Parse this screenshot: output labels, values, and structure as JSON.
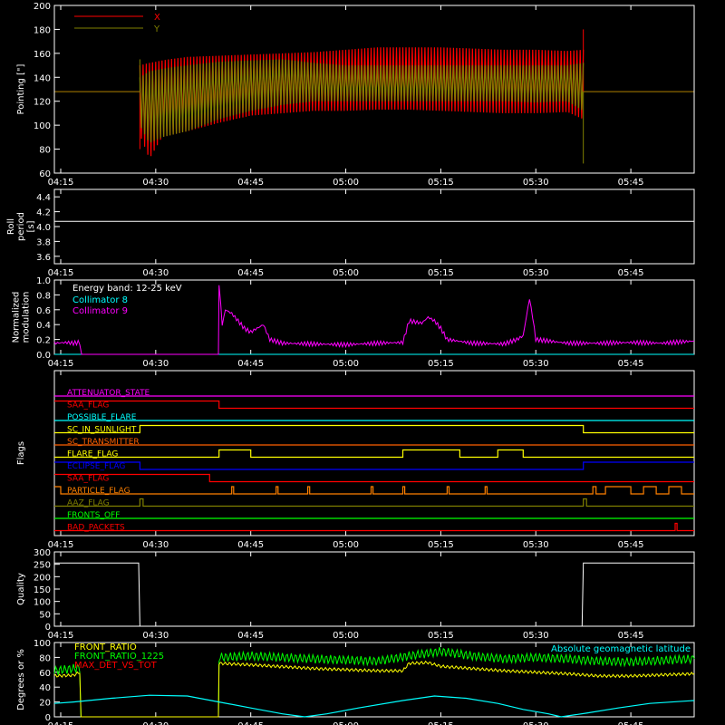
{
  "x_axis": {
    "range_minutes": [
      -1,
      100
    ],
    "ticks": [
      {
        "label": "04:15",
        "m": 0
      },
      {
        "label": "04:30",
        "m": 15
      },
      {
        "label": "04:45",
        "m": 30
      },
      {
        "label": "05:00",
        "m": 45
      },
      {
        "label": "05:15",
        "m": 60
      },
      {
        "label": "05:30",
        "m": 75
      },
      {
        "label": "05:45",
        "m": 90
      }
    ]
  },
  "chart_data": [
    {
      "type": "line",
      "ylabel": "Pointing [\"]",
      "ylim": [
        60,
        200
      ],
      "yticks": [
        60,
        80,
        100,
        120,
        140,
        160,
        180,
        200
      ],
      "series": [
        {
          "name": "X",
          "color": "#ff0000",
          "baseline": 128,
          "data_start": 12.5,
          "data_end": 82.5,
          "band_top": [
            [
              12.5,
              150
            ],
            [
              14,
              152
            ],
            [
              17,
              155
            ],
            [
              20,
              157
            ],
            [
              25,
              158
            ],
            [
              30,
              159
            ],
            [
              35,
              160
            ],
            [
              40,
              161
            ],
            [
              45,
              163
            ],
            [
              50,
              165
            ],
            [
              55,
              165
            ],
            [
              60,
              165
            ],
            [
              65,
              164
            ],
            [
              70,
              163
            ],
            [
              75,
              163
            ],
            [
              80,
              162
            ],
            [
              82.5,
              163
            ]
          ],
          "band_bottom": [
            [
              12.5,
              92
            ],
            [
              14,
              72
            ],
            [
              16,
              90
            ],
            [
              20,
              95
            ],
            [
              25,
              102
            ],
            [
              30,
              108
            ],
            [
              35,
              110
            ],
            [
              40,
              112
            ],
            [
              45,
              112
            ],
            [
              50,
              113
            ],
            [
              55,
              113
            ],
            [
              60,
              112
            ],
            [
              65,
              111
            ],
            [
              70,
              110
            ],
            [
              75,
              110
            ],
            [
              80,
              111
            ],
            [
              82.5,
              105
            ]
          ],
          "spikes": [
            [
              12.5,
              80
            ],
            [
              82.5,
              180
            ]
          ]
        },
        {
          "name": "Y",
          "color": "#808000",
          "baseline": 128,
          "data_start": 12.5,
          "data_end": 82.5,
          "band_top": [
            [
              12.5,
              140
            ],
            [
              14,
              145
            ],
            [
              17,
              148
            ],
            [
              20,
              150
            ],
            [
              25,
              153
            ],
            [
              30,
              154
            ],
            [
              35,
              155
            ],
            [
              40,
              152
            ],
            [
              45,
              150
            ],
            [
              50,
              150
            ],
            [
              55,
              150
            ],
            [
              60,
              150
            ],
            [
              65,
              150
            ],
            [
              70,
              150
            ],
            [
              75,
              150
            ],
            [
              80,
              150
            ],
            [
              82.5,
              152
            ]
          ],
          "band_bottom": [
            [
              12.5,
              100
            ],
            [
              14,
              85
            ],
            [
              16,
              90
            ],
            [
              20,
              95
            ],
            [
              25,
              105
            ],
            [
              30,
              112
            ],
            [
              35,
              117
            ],
            [
              40,
              120
            ],
            [
              45,
              120
            ],
            [
              50,
              120
            ],
            [
              55,
              120
            ],
            [
              60,
              120
            ],
            [
              65,
              120
            ],
            [
              70,
              120
            ],
            [
              75,
              119
            ],
            [
              80,
              120
            ],
            [
              82.5,
              112
            ]
          ],
          "spikes": [
            [
              12.5,
              155
            ],
            [
              82.5,
              68
            ]
          ]
        }
      ]
    },
    {
      "type": "line",
      "ylabel": "Roll period [s]",
      "ylim": [
        3.5,
        4.5
      ],
      "yticks": [
        3.6,
        3.8,
        4.0,
        4.2,
        4.4
      ],
      "series": [
        {
          "color": "#ffffff",
          "points": [
            [
              -1,
              4.07
            ],
            [
              100,
              4.07
            ]
          ]
        }
      ]
    },
    {
      "type": "line",
      "ylabel": "Normalized modulation",
      "ylim": [
        0,
        1.0
      ],
      "yticks": [
        0.0,
        0.2,
        0.4,
        0.6,
        0.8,
        1.0
      ],
      "annotation": "Energy band: 12-25 keV",
      "series": [
        {
          "name": "Collimator 8",
          "color": "#00ffff",
          "points": [
            [
              -1,
              0
            ],
            [
              100,
              0
            ]
          ]
        },
        {
          "name": "Collimator 9",
          "color": "#ff00ff",
          "points": [
            [
              -1,
              0.15
            ],
            [
              1,
              0.16
            ],
            [
              2,
              0.15
            ],
            [
              3,
              0.16
            ],
            [
              3.3,
              0.0
            ],
            [
              24.9,
              0.0
            ],
            [
              25,
              0.95
            ],
            [
              25.5,
              0.4
            ],
            [
              26,
              0.6
            ],
            [
              27,
              0.55
            ],
            [
              28,
              0.45
            ],
            [
              29,
              0.35
            ],
            [
              30,
              0.3
            ],
            [
              31,
              0.35
            ],
            [
              32,
              0.4
            ],
            [
              33,
              0.2
            ],
            [
              35,
              0.15
            ],
            [
              40,
              0.14
            ],
            [
              45,
              0.13
            ],
            [
              50,
              0.15
            ],
            [
              54,
              0.16
            ],
            [
              55,
              0.45
            ],
            [
              57,
              0.42
            ],
            [
              58,
              0.5
            ],
            [
              59,
              0.45
            ],
            [
              60,
              0.35
            ],
            [
              61,
              0.2
            ],
            [
              65,
              0.15
            ],
            [
              70,
              0.14
            ],
            [
              72,
              0.2
            ],
            [
              73,
              0.25
            ],
            [
              74,
              0.75
            ],
            [
              74.5,
              0.5
            ],
            [
              75,
              0.2
            ],
            [
              80,
              0.15
            ],
            [
              85,
              0.15
            ],
            [
              90,
              0.16
            ],
            [
              95,
              0.15
            ],
            [
              100,
              0.18
            ]
          ]
        }
      ]
    },
    {
      "type": "line",
      "ylabel": "Flags",
      "flags": [
        {
          "name": "ATTENUATOR_STATE",
          "color": "#ff00ff",
          "steps": [
            [
              -1,
              0
            ]
          ]
        },
        {
          "name": "SAA_FLAG",
          "color": "#ff0000",
          "steps": [
            [
              -1,
              1
            ],
            [
              25,
              0
            ]
          ]
        },
        {
          "name": "POSSIBLE_FLARE",
          "color": "#00ffff",
          "steps": [
            [
              -1,
              0
            ]
          ]
        },
        {
          "name": "SC_IN_SUNLIGHT",
          "color": "#ffff00",
          "steps": [
            [
              -1,
              0
            ],
            [
              12.5,
              1
            ],
            [
              82.5,
              0
            ]
          ]
        },
        {
          "name": "SC_TRANSMITTER",
          "color": "#ff6000",
          "steps": [
            [
              -1,
              0
            ]
          ]
        },
        {
          "name": "FLARE_FLAG",
          "color": "#ffff00",
          "steps": [
            [
              -1,
              0
            ],
            [
              25,
              1
            ],
            [
              30,
              0
            ],
            [
              54,
              1
            ],
            [
              63,
              0
            ],
            [
              69,
              1
            ],
            [
              73,
              0
            ]
          ]
        },
        {
          "name": "ECLIPSE_FLAG",
          "color": "#0000ff",
          "steps": [
            [
              -1,
              1
            ],
            [
              12.5,
              0
            ],
            [
              82.5,
              1
            ]
          ]
        },
        {
          "name": "SAA_FLAG",
          "color": "#ff0000",
          "steps": [
            [
              -1,
              1
            ],
            [
              23.5,
              0
            ]
          ]
        },
        {
          "name": "PARTICLE_FLAG",
          "color": "#ff8000",
          "steps": [
            [
              -1,
              1
            ],
            [
              0,
              0
            ],
            [
              27,
              1
            ],
            [
              27.3,
              0
            ],
            [
              34,
              1
            ],
            [
              34.3,
              0
            ],
            [
              39,
              1
            ],
            [
              39.3,
              0
            ],
            [
              49,
              1
            ],
            [
              49.3,
              0
            ],
            [
              54,
              1
            ],
            [
              54.3,
              0
            ],
            [
              61,
              1
            ],
            [
              61.3,
              0
            ],
            [
              67,
              1
            ],
            [
              67.3,
              0
            ],
            [
              84,
              1
            ],
            [
              84.5,
              0
            ],
            [
              86,
              1
            ],
            [
              90,
              0
            ],
            [
              92,
              1
            ],
            [
              94,
              0
            ],
            [
              96,
              1
            ],
            [
              98,
              0
            ]
          ]
        },
        {
          "name": "AAZ_FLAG",
          "color": "#808000",
          "steps": [
            [
              -1,
              0
            ],
            [
              12.5,
              1
            ],
            [
              13,
              0
            ],
            [
              82.5,
              1
            ],
            [
              83,
              0
            ]
          ]
        },
        {
          "name": "FRONTS_OFF",
          "color": "#00ff00",
          "steps": [
            [
              -1,
              0
            ]
          ]
        },
        {
          "name": "BAD_PACKETS",
          "color": "#ff0000",
          "steps": [
            [
              -1,
              0
            ],
            [
              97,
              1
            ],
            [
              97.3,
              0
            ]
          ]
        }
      ]
    },
    {
      "type": "line",
      "ylabel": "Quality",
      "ylim": [
        0,
        300
      ],
      "yticks": [
        0,
        50,
        100,
        150,
        200,
        250,
        300
      ],
      "series": [
        {
          "color": "#ffffff",
          "points": [
            [
              -1,
              255
            ],
            [
              12.3,
              255
            ],
            [
              12.5,
              0
            ],
            [
              82.3,
              0
            ],
            [
              82.5,
              255
            ],
            [
              100,
              255
            ]
          ]
        }
      ]
    },
    {
      "type": "line",
      "ylabel": "Degrees or %",
      "ylim": [
        0,
        100
      ],
      "yticks": [
        0,
        20,
        40,
        60,
        80,
        100
      ],
      "series": [
        {
          "name": "FRONT_RATIO",
          "color": "#ffff00",
          "points": [
            [
              -1,
              55
            ],
            [
              2,
              56
            ],
            [
              3,
              60
            ],
            [
              3.2,
              0
            ],
            [
              24.9,
              0
            ],
            [
              25,
              72
            ],
            [
              30,
              70
            ],
            [
              40,
              65
            ],
            [
              50,
              62
            ],
            [
              54,
              62
            ],
            [
              55,
              72
            ],
            [
              58,
              73
            ],
            [
              60,
              68
            ],
            [
              70,
              62
            ],
            [
              80,
              58
            ],
            [
              85,
              55
            ],
            [
              90,
              55
            ],
            [
              100,
              58
            ]
          ]
        },
        {
          "name": "FRONT_RATIO_1225",
          "color": "#00ff00",
          "points": [
            [
              -1,
              62
            ],
            [
              3,
              66
            ],
            [
              3.2,
              0
            ],
            [
              24.9,
              0
            ],
            [
              25,
              80
            ],
            [
              30,
              82
            ],
            [
              40,
              78
            ],
            [
              50,
              75
            ],
            [
              55,
              82
            ],
            [
              60,
              88
            ],
            [
              65,
              82
            ],
            [
              70,
              78
            ],
            [
              75,
              80
            ],
            [
              80,
              78
            ],
            [
              85,
              75
            ],
            [
              90,
              74
            ],
            [
              95,
              76
            ],
            [
              100,
              78
            ]
          ]
        },
        {
          "name": "MAX_DET_VS_TOT",
          "color": "#ff0000",
          "points": []
        },
        {
          "name": "Absolute geomagnetic latitude",
          "color": "#00ffff",
          "points": [
            [
              -1,
              18
            ],
            [
              2,
              20
            ],
            [
              8,
              25
            ],
            [
              14,
              29
            ],
            [
              20,
              28
            ],
            [
              25,
              20
            ],
            [
              30,
              12
            ],
            [
              35,
              4
            ],
            [
              38.5,
              0
            ],
            [
              42,
              4
            ],
            [
              47,
              12
            ],
            [
              54,
              22
            ],
            [
              59,
              28
            ],
            [
              64,
              25
            ],
            [
              69,
              18
            ],
            [
              73,
              10
            ],
            [
              77,
              4
            ],
            [
              79,
              0
            ],
            [
              83,
              5
            ],
            [
              88,
              12
            ],
            [
              93,
              18
            ],
            [
              100,
              22
            ]
          ]
        }
      ]
    }
  ]
}
